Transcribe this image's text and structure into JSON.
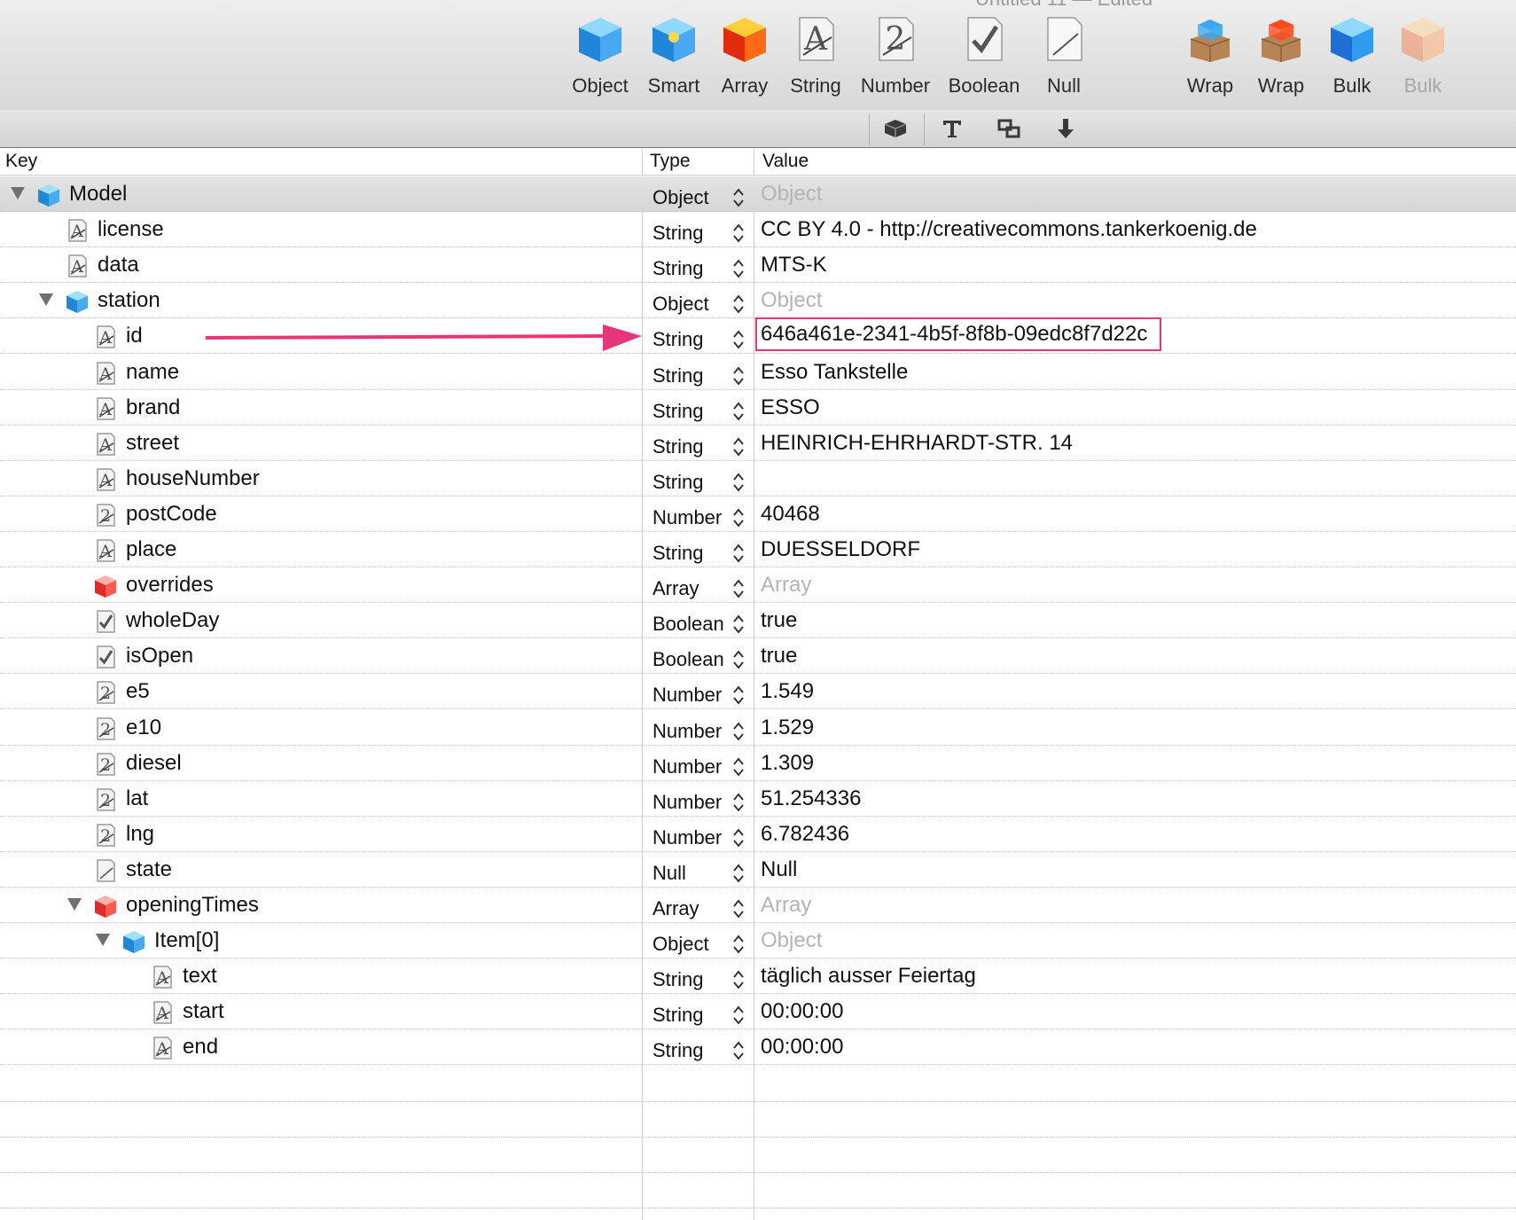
{
  "window": {
    "title": "Untitled 11 — Edited"
  },
  "toolbar": {
    "buttons": [
      {
        "label": "Object",
        "icon": "cube-blue-icon"
      },
      {
        "label": "Smart",
        "icon": "smart-cube-icon"
      },
      {
        "label": "Array",
        "icon": "cube-red-icon"
      },
      {
        "label": "String",
        "icon": "string-a-icon"
      },
      {
        "label": "Number",
        "icon": "number-2-icon"
      },
      {
        "label": "Boolean",
        "icon": "boolean-check-icon"
      },
      {
        "label": "Null",
        "icon": "null-page-icon"
      },
      {
        "label": "Wrap",
        "icon": "wrap-blue-box-icon"
      },
      {
        "label": "Wrap",
        "icon": "wrap-red-box-icon"
      },
      {
        "label": "Bulk",
        "icon": "bulk-blue-cube-icon"
      },
      {
        "label": "Bulk",
        "icon": "bulk-orange-cube-icon",
        "disabled": true
      }
    ]
  },
  "subbar": {
    "segments": [
      "cube-segment-icon",
      "text-t-icon",
      "link-boxes-icon",
      "arrow-down-icon"
    ]
  },
  "columns": {
    "key": "Key",
    "type": "Type",
    "value": "Value"
  },
  "rows": [
    {
      "key": "Model",
      "icon": "object",
      "level": 0,
      "expanded": true,
      "type": "Object",
      "value": "Object",
      "placeholder": true
    },
    {
      "key": "license",
      "icon": "string",
      "level": 1,
      "type": "String",
      "value": "CC BY 4.0 -  http://creativecommons.tankerkoenig.de"
    },
    {
      "key": "data",
      "icon": "string",
      "level": 1,
      "type": "String",
      "value": "MTS-K"
    },
    {
      "key": "station",
      "icon": "object",
      "level": 1,
      "expanded": true,
      "type": "Object",
      "value": "Object",
      "placeholder": true
    },
    {
      "key": "id",
      "icon": "string",
      "level": 2,
      "type": "String",
      "value": "646a461e-2341-4b5f-8f8b-09edc8f7d22c",
      "highlight": true
    },
    {
      "key": "name",
      "icon": "string",
      "level": 2,
      "type": "String",
      "value": "Esso Tankstelle"
    },
    {
      "key": "brand",
      "icon": "string",
      "level": 2,
      "type": "String",
      "value": "ESSO"
    },
    {
      "key": "street",
      "icon": "string",
      "level": 2,
      "type": "String",
      "value": "HEINRICH-EHRHARDT-STR. 14"
    },
    {
      "key": "houseNumber",
      "icon": "string",
      "level": 2,
      "type": "String",
      "value": ""
    },
    {
      "key": "postCode",
      "icon": "number",
      "level": 2,
      "type": "Number",
      "value": "40468"
    },
    {
      "key": "place",
      "icon": "string",
      "level": 2,
      "type": "String",
      "value": "DUESSELDORF"
    },
    {
      "key": "overrides",
      "icon": "array",
      "level": 2,
      "type": "Array",
      "value": "Array",
      "placeholder": true
    },
    {
      "key": "wholeDay",
      "icon": "boolean",
      "level": 2,
      "type": "Boolean",
      "value": "true"
    },
    {
      "key": "isOpen",
      "icon": "boolean",
      "level": 2,
      "type": "Boolean",
      "value": "true"
    },
    {
      "key": "e5",
      "icon": "number",
      "level": 2,
      "type": "Number",
      "value": "1.549"
    },
    {
      "key": "e10",
      "icon": "number",
      "level": 2,
      "type": "Number",
      "value": "1.529"
    },
    {
      "key": "diesel",
      "icon": "number",
      "level": 2,
      "type": "Number",
      "value": "1.309"
    },
    {
      "key": "lat",
      "icon": "number",
      "level": 2,
      "type": "Number",
      "value": "51.254336"
    },
    {
      "key": "lng",
      "icon": "number",
      "level": 2,
      "type": "Number",
      "value": "6.782436"
    },
    {
      "key": "state",
      "icon": "null",
      "level": 2,
      "type": "Null",
      "value": "Null"
    },
    {
      "key": "openingTimes",
      "icon": "array",
      "level": 2,
      "expanded": true,
      "type": "Array",
      "value": "Array",
      "placeholder": true
    },
    {
      "key": "Item[0]",
      "icon": "object",
      "level": 3,
      "expanded": true,
      "type": "Object",
      "value": "Object",
      "placeholder": true
    },
    {
      "key": "text",
      "icon": "string",
      "level": 4,
      "type": "String",
      "value": "täglich ausser Feiertag"
    },
    {
      "key": "start",
      "icon": "string",
      "level": 4,
      "type": "String",
      "value": "00:00:00"
    },
    {
      "key": "end",
      "icon": "string",
      "level": 4,
      "type": "String",
      "value": "00:00:00"
    }
  ],
  "annotation": {
    "arrow_color": "#e8357a",
    "highlight_color": "#e8357a"
  }
}
